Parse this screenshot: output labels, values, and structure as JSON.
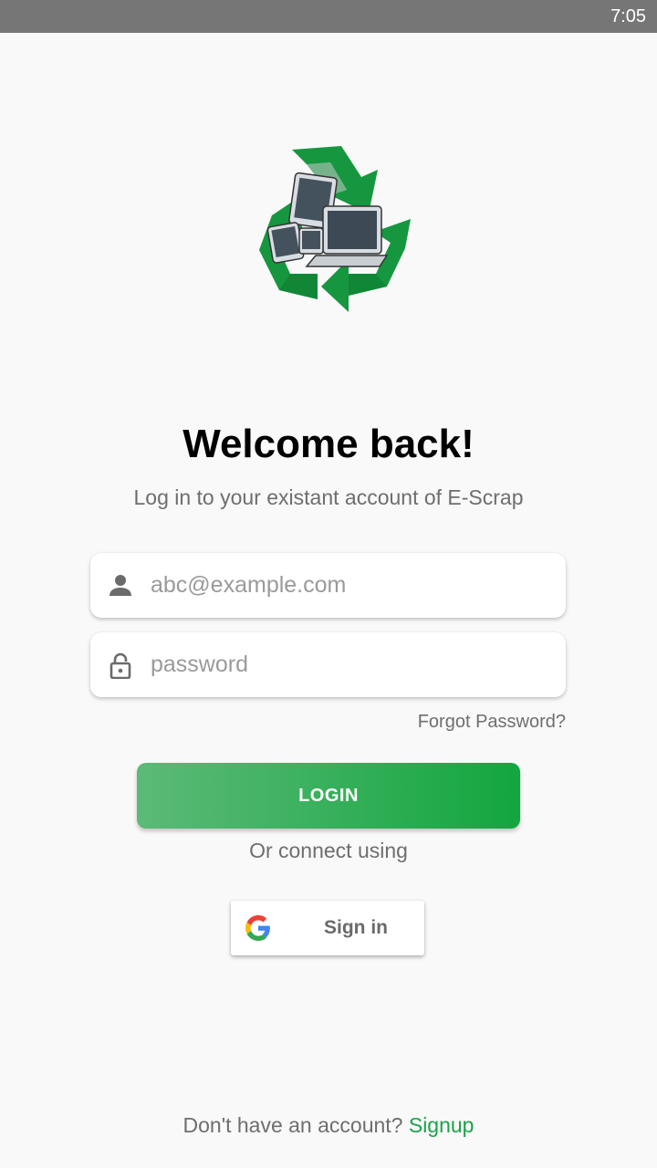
{
  "status_bar": {
    "time": "7:05"
  },
  "logo": {
    "icon": "e-scrap-recycle-devices-logo",
    "brand_color": "#13a63f"
  },
  "welcome": {
    "title": "Welcome back!",
    "subtitle": "Log in to your existant account of E-Scrap"
  },
  "form": {
    "email": {
      "placeholder": "abc@example.com",
      "value": "",
      "icon": "person-icon"
    },
    "password": {
      "placeholder": "password",
      "value": "",
      "icon": "lock-icon"
    },
    "forgot_label": "Forgot Password?",
    "login_label": "LOGIN"
  },
  "social": {
    "or_label": "Or connect using",
    "google_label": "Sign in",
    "google_icon": "google-g-icon"
  },
  "footer": {
    "prompt": "Don't have an account?",
    "signup_label": "Signup"
  },
  "colors": {
    "accent": "#13a63f",
    "accent_light": "#5cba78",
    "background": "#f9f9f9",
    "status_bar": "#767676"
  }
}
